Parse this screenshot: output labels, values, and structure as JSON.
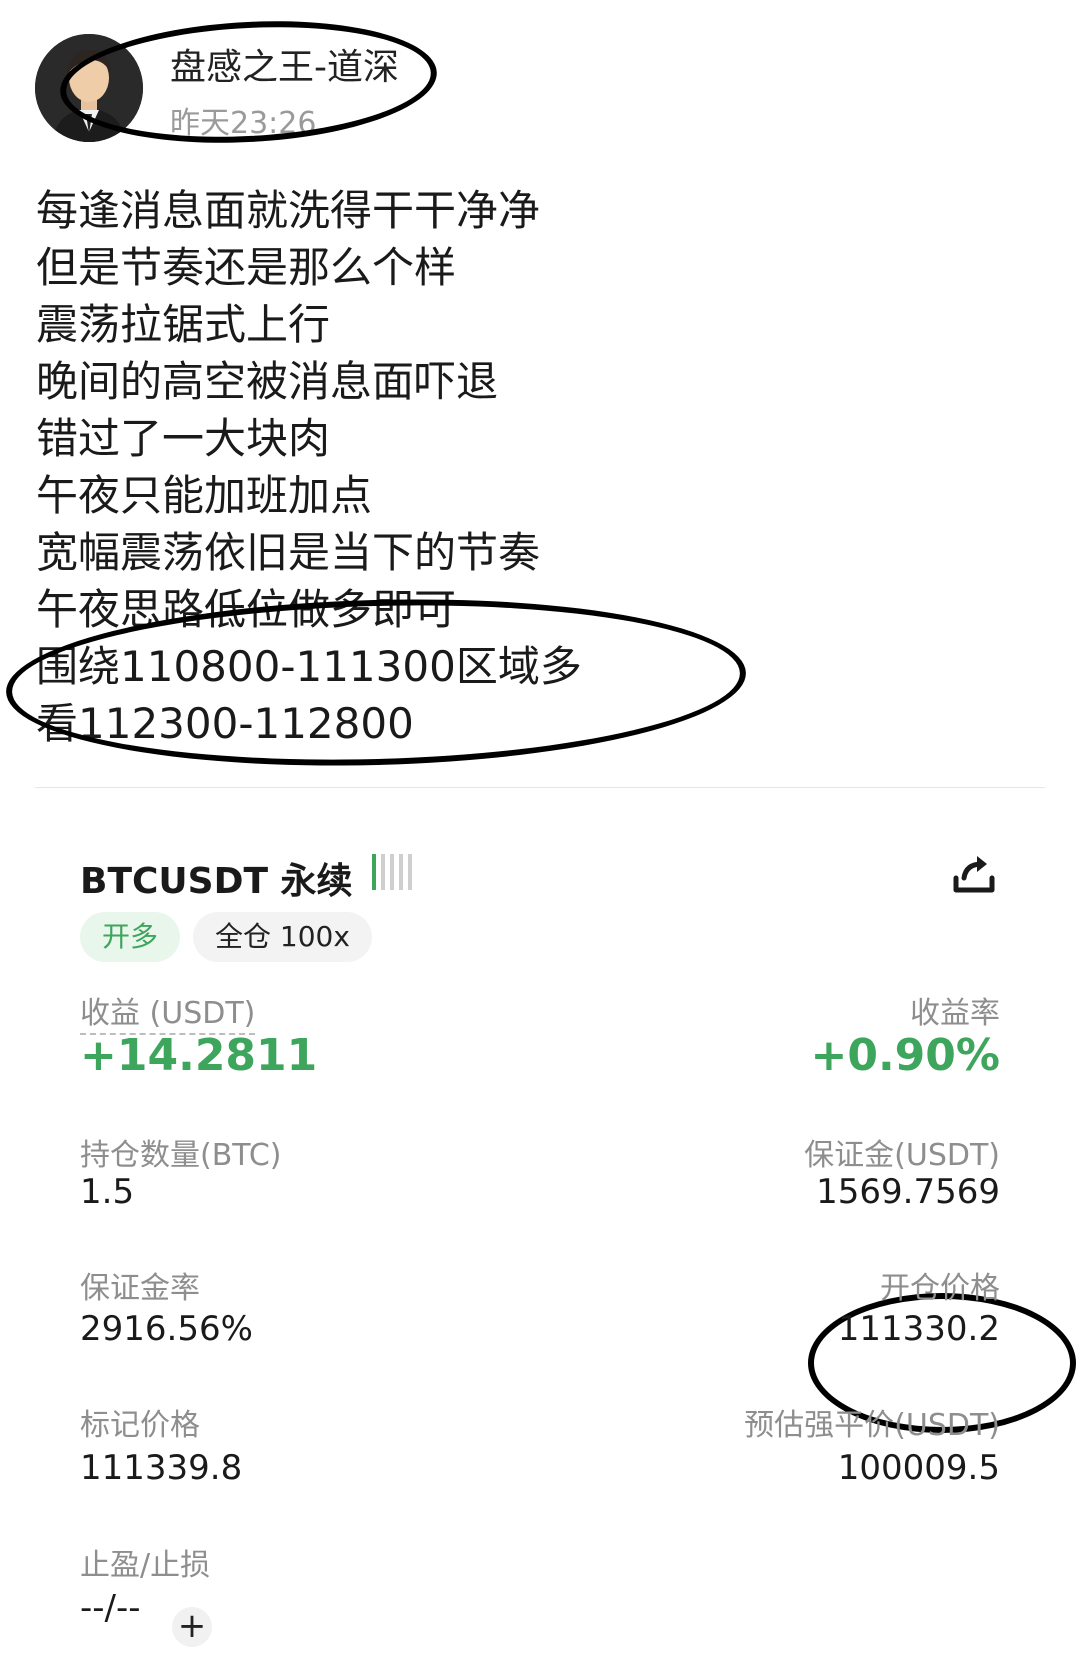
{
  "post": {
    "username": "盘感之王-道深",
    "time": "昨天23:26",
    "lines": [
      "每逢消息面就洗得干干净净",
      "但是节奏还是那么个样",
      "震荡拉锯式上行",
      "晚间的高空被消息面吓退",
      "错过了一大块肉",
      "午夜只能加班加点",
      "宽幅震荡依旧是当下的节奏",
      "午夜思路低位做多即可",
      "围绕110800-111300区域多",
      "看112300-112800"
    ]
  },
  "position": {
    "symbol": "BTCUSDT 永续",
    "direction_tag": "开多",
    "margin_tag": "全仓 100x",
    "pnl_label": "收益 (USDT)",
    "pnl_value": "+14.2811",
    "roe_label": "收益率",
    "roe_value": "+0.90%",
    "size_label": "持仓数量(BTC)",
    "size_value": "1.5",
    "margin_label": "保证金(USDT)",
    "margin_value": "1569.7569",
    "margin_ratio_label": "保证金率",
    "margin_ratio_value": "2916.56%",
    "entry_label": "开仓价格",
    "entry_value": "111330.2",
    "mark_label": "标记价格",
    "mark_value": "111339.8",
    "liq_label": "预估强平价(USDT)",
    "liq_value": "100009.5",
    "tpsl_label": "止盈/止损",
    "tpsl_value": "--/--",
    "add_symbol": "+"
  },
  "colors": {
    "profit_green": "#3ea55d",
    "label_gray": "#8e8e8e",
    "annotation": "#000000"
  },
  "icons": {
    "share": "share-arrow-icon",
    "signal": "signal-bars-icon"
  }
}
